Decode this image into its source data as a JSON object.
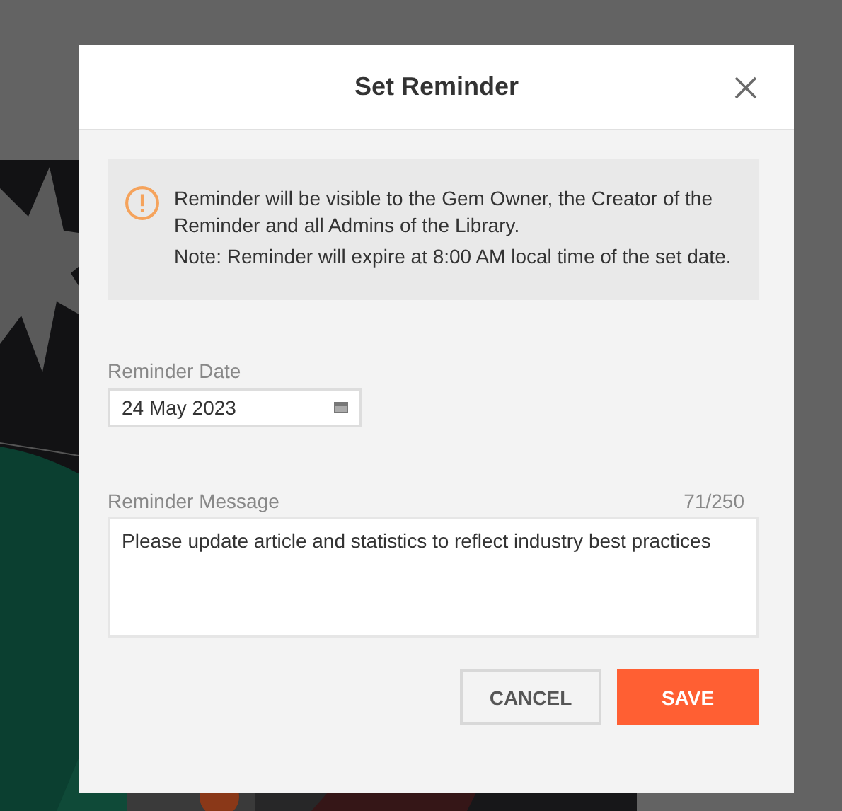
{
  "dialog": {
    "title": "Set Reminder",
    "notice": [
      "Reminder will be visible to the Gem Owner, the Creator of the Reminder and all Admins of the Library.",
      "Note: Reminder will expire at 8:00 AM local time of the set date."
    ],
    "date_field": {
      "label": "Reminder Date",
      "value": "24 May 2023"
    },
    "message_field": {
      "label": "Reminder Message",
      "counter": "71/250",
      "value": "Please update article and statistics to reflect industry best practices"
    },
    "buttons": [
      {
        "label": "CANCEL",
        "kind": "secondary"
      },
      {
        "label": "SAVE",
        "kind": "primary"
      }
    ]
  }
}
